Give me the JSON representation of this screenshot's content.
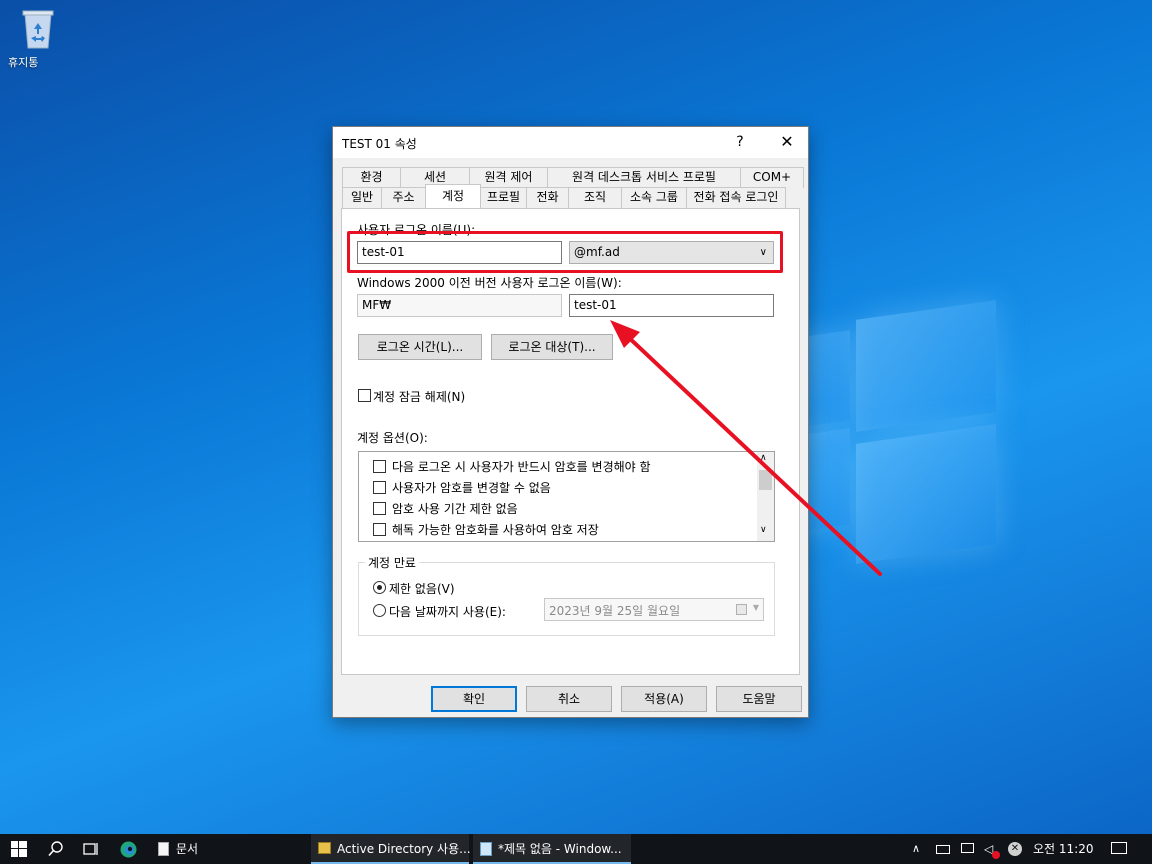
{
  "desktop": {
    "recycle_bin_label": "휴지통"
  },
  "dialog": {
    "title": "TEST 01 속성",
    "help_label": "?",
    "close_label": "✕",
    "tabs_back": [
      "환경",
      "세션",
      "원격 제어",
      "원격 데스크톱 서비스 프로필",
      "COM+"
    ],
    "tabs_front": [
      "일반",
      "주소",
      "계정",
      "프로필",
      "전화",
      "조직",
      "소속 그룹",
      "전화 접속 로그인"
    ],
    "active_tab": "계정",
    "logon_name_label": "사용자 로그온 이름(U):",
    "logon_name_value": "test-01",
    "domain_value": "@mf.ad",
    "pre2000_label": "Windows 2000 이전 버전 사용자 로그온 이름(W):",
    "pre2000_domain": "MF₩",
    "pre2000_name": "test-01",
    "logon_hours_button": "로그온 시간(L)...",
    "logon_to_button": "로그온 대상(T)...",
    "unlock_label": "계정 잠금 해제(N)",
    "account_options_label": "계정 옵션(O):",
    "account_options": [
      "다음 로그온 시 사용자가 반드시 암호를 변경해야 함",
      "사용자가 암호를 변경할 수 없음",
      "암호 사용 기간 제한 없음",
      "해독 가능한 암호화를 사용하여 암호 저장"
    ],
    "expires_group_label": "계정 만료",
    "never_label": "제한 없음(V)",
    "end_of_label": "다음 날짜까지 사용(E):",
    "expiry_date": "2023년   9월 25일 월요일",
    "ok_button": "확인",
    "cancel_button": "취소",
    "apply_button": "적용(A)",
    "help_button": "도움말"
  },
  "taskbar": {
    "items": [
      "문서",
      "Active Directory 사용...",
      "*제목 없음 - Window..."
    ],
    "clock": "오전 11:20"
  },
  "colors": {
    "highlight": "#e81123",
    "accent": "#0078d7"
  }
}
